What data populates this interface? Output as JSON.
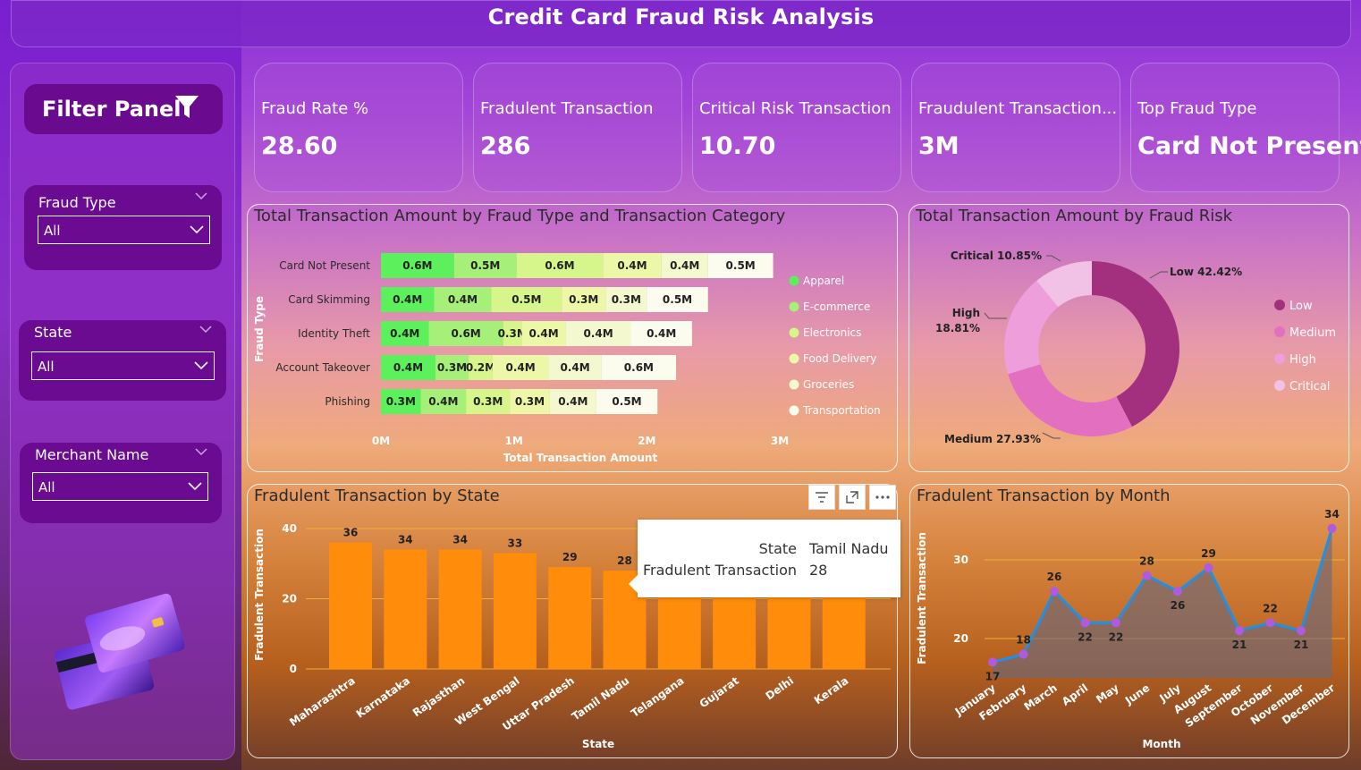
{
  "title": "Credit Card Fraud Risk Analysis",
  "filter_panel": {
    "header": "Filter Panel",
    "slicers": [
      {
        "label": "Fraud Type",
        "value": "All"
      },
      {
        "label": "State",
        "value": "All"
      },
      {
        "label": "Merchant Name",
        "value": "All"
      }
    ]
  },
  "kpis": [
    {
      "label": "Fraud Rate %",
      "value": "28.60"
    },
    {
      "label": "Fradulent Transaction",
      "value": "286"
    },
    {
      "label": "Critical Risk Transaction",
      "value": "10.70"
    },
    {
      "label": "Fraudulent Transaction...",
      "value": "3M"
    },
    {
      "label": "Top Fraud Type",
      "value": "Card Not Present"
    }
  ],
  "colors": {
    "bar_orange": "#ff8c0a",
    "line_blue": "#1e90e8",
    "marker": "#b05ae0",
    "donut_low": "#a3307e",
    "donut_medium": "#e26fc0",
    "donut_high": "#ee9edb",
    "donut_critical": "#f2c2e6"
  },
  "chart_data": [
    {
      "type": "bar",
      "subtype": "stacked-horizontal",
      "title": "Total Transaction Amount by Fraud Type and Transaction Category",
      "xlabel": "Total Transaction Amount",
      "ylabel": "Fraud Type",
      "xlim": [
        0,
        3000000
      ],
      "x_ticks": [
        "0M",
        "1M",
        "2M",
        "3M"
      ],
      "categories": [
        "Card Not Present",
        "Card Skimming",
        "Identity Theft",
        "Account Takeover",
        "Phishing"
      ],
      "series": [
        {
          "name": "Apparel",
          "color": "#5cf05c",
          "values": [
            0.55,
            0.4,
            0.36,
            0.41,
            0.3
          ],
          "labels": [
            "0.6M",
            "0.4M",
            "0.4M",
            "0.4M",
            "0.3M"
          ]
        },
        {
          "name": "E-commerce",
          "color": "#a6f07a",
          "values": [
            0.47,
            0.43,
            0.56,
            0.25,
            0.34
          ],
          "labels": [
            "0.5M",
            "0.4M",
            "0.6M",
            "0.3M",
            "0.4M"
          ]
        },
        {
          "name": "Electronics",
          "color": "#d6f58a",
          "values": [
            0.65,
            0.53,
            0.14,
            0.18,
            0.33
          ],
          "labels": [
            "0.6M",
            "0.5M",
            "0.3M",
            "0.2M",
            "0.3M"
          ]
        },
        {
          "name": "Food Delivery",
          "color": "#ecf7a8",
          "values": [
            0.44,
            0.33,
            0.33,
            0.42,
            0.3
          ],
          "labels": [
            "0.4M",
            "0.3M",
            "0.4M",
            "0.4M",
            "0.3M"
          ]
        },
        {
          "name": "Groceries",
          "color": "#f3f8cf",
          "values": [
            0.35,
            0.31,
            0.49,
            0.4,
            0.35
          ],
          "labels": [
            "0.4M",
            "0.3M",
            "0.4M",
            "0.4M",
            "0.4M"
          ]
        },
        {
          "name": "Transportation",
          "color": "#fbfbee",
          "values": [
            0.49,
            0.46,
            0.46,
            0.56,
            0.46
          ],
          "labels": [
            "0.5M",
            "0.5M",
            "0.4M",
            "0.6M",
            "0.5M"
          ]
        }
      ],
      "legend": "right"
    },
    {
      "type": "pie",
      "subtype": "donut",
      "title": "Total Transaction Amount by Fraud Risk",
      "categories": [
        "Low",
        "Medium",
        "High",
        "Critical"
      ],
      "values": [
        42.42,
        27.93,
        18.81,
        10.85
      ],
      "labels": [
        "Low 42.42%",
        "Medium 27.93%",
        "High",
        "18.81%",
        "Critical 10.85%"
      ],
      "legend": "right"
    },
    {
      "type": "bar",
      "title": "Fradulent Transaction by State",
      "xlabel": "State",
      "ylabel": "Fradulent Transaction",
      "ylim": [
        0,
        40
      ],
      "y_ticks": [
        0,
        20,
        40
      ],
      "categories": [
        "Maharashtra",
        "Karnataka",
        "Rajasthan",
        "West Bengal",
        "Uttar Pradesh",
        "Tamil Nadu",
        "Telangana",
        "Gujarat",
        "Delhi",
        "Kerala"
      ],
      "values": [
        36,
        34,
        34,
        33,
        29,
        28,
        25,
        25,
        25,
        25
      ],
      "data_labels": [
        "36",
        "34",
        "34",
        "33",
        "29",
        "28"
      ],
      "tooltip": {
        "state_label": "State",
        "state_value": "Tamil Nadu",
        "metric_label": "Fradulent Transaction",
        "metric_value": "28"
      }
    },
    {
      "type": "area",
      "title": "Fradulent Transaction by Month",
      "xlabel": "Month",
      "ylabel": "Fradulent Transaction",
      "y_ticks": [
        20,
        30
      ],
      "categories": [
        "January",
        "February",
        "March",
        "April",
        "May",
        "June",
        "July",
        "August",
        "September",
        "October",
        "November",
        "December"
      ],
      "values": [
        17,
        18,
        26,
        22,
        22,
        28,
        26,
        29,
        21,
        22,
        21,
        34
      ]
    }
  ]
}
